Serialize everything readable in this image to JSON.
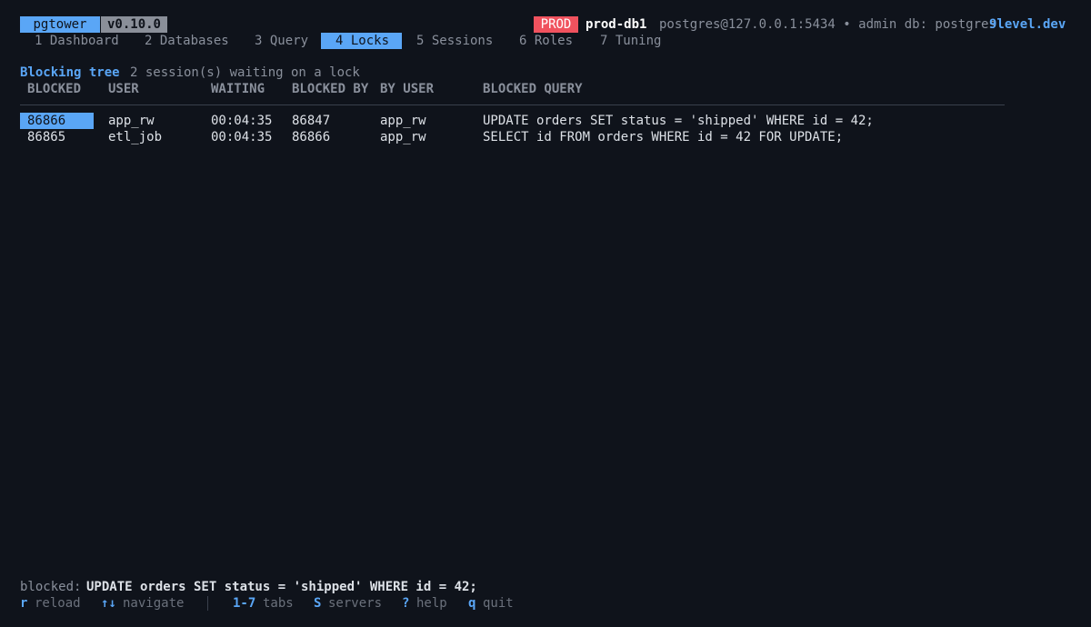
{
  "header": {
    "app_name": "pgtower",
    "version": "v0.10.0",
    "env": "PROD",
    "server": "prod-db1",
    "connection": "postgres@127.0.0.1:5434 • admin db: postgres",
    "brand": "9level.dev"
  },
  "tabs": [
    {
      "label": "1 Dashboard",
      "active": false
    },
    {
      "label": "2 Databases",
      "active": false
    },
    {
      "label": "3 Query",
      "active": false
    },
    {
      "label": "4 Locks",
      "active": true
    },
    {
      "label": "5 Sessions",
      "active": false
    },
    {
      "label": "6 Roles",
      "active": false
    },
    {
      "label": "7 Tuning",
      "active": false
    }
  ],
  "section": {
    "title": "Blocking tree",
    "subtitle": "2 session(s) waiting on a lock"
  },
  "table": {
    "columns": [
      "BLOCKED",
      "USER",
      "WAITING",
      "BLOCKED BY",
      "BY USER",
      "BLOCKED QUERY"
    ],
    "rows": [
      [
        "86866",
        "app_rw",
        "00:04:35",
        "86847",
        "app_rw",
        "UPDATE orders SET status = 'shipped' WHERE id = 42;"
      ],
      [
        "86865",
        "etl_job",
        "00:04:35",
        "86866",
        "app_rw",
        "SELECT id FROM orders WHERE id = 42 FOR UPDATE;"
      ]
    ],
    "selected_row": 0
  },
  "detail": {
    "label": "blocked:",
    "value": "UPDATE orders SET status = 'shipped' WHERE id = 42;"
  },
  "footer": {
    "shortcuts": [
      {
        "key": "r",
        "label": "reload"
      },
      {
        "key": "↑↓",
        "label": "navigate"
      },
      {
        "key": "1-7",
        "label": "tabs"
      },
      {
        "key": "S",
        "label": "servers"
      },
      {
        "key": "?",
        "label": "help"
      },
      {
        "key": "q",
        "label": "quit"
      }
    ]
  },
  "colors": {
    "background": "#0f131b",
    "accent": "#5aa6f6",
    "prod_badge": "#f0525e",
    "muted": "#8a909c"
  }
}
